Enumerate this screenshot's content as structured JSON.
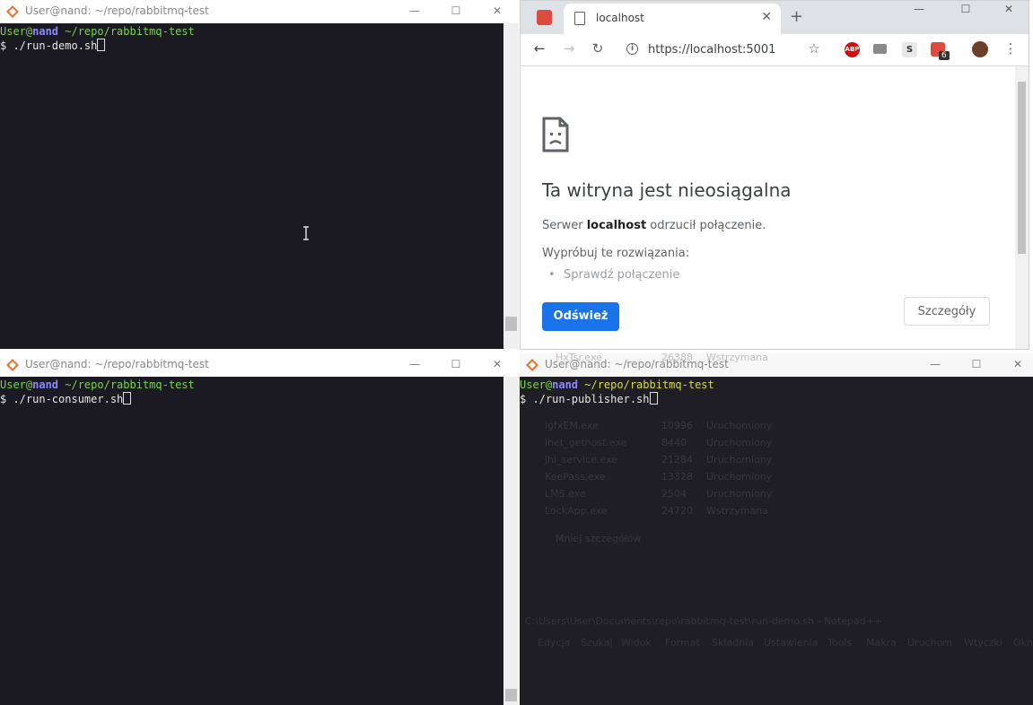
{
  "terminals": {
    "demo": {
      "title": "User@nand: ~/repo/rabbitmq-test",
      "prompt_user": "User@",
      "prompt_host": "nand",
      "prompt_path": " ~/repo/rabbitmq-test",
      "dollar": "$",
      "command": " ./run-demo.sh"
    },
    "consumer": {
      "title": "User@nand: ~/repo/rabbitmq-test",
      "prompt_user": "User@",
      "prompt_host": "nand",
      "prompt_path": " ~/repo/rabbitmq-test",
      "dollar": "$",
      "command": " ./run-consumer.sh"
    },
    "publisher": {
      "title": "User@nand: ~/repo/rabbitmq-test",
      "prompt_user": "User@",
      "prompt_host": "nand",
      "prompt_path": " ~/repo/rabbitmq-test",
      "dollar": "$",
      "command": " ./run-publisher.sh"
    }
  },
  "window_buttons": {
    "minimize": "—",
    "maximize": "☐",
    "close": "✕"
  },
  "browser": {
    "tab_title": "localhost",
    "tab_close": "✕",
    "new_tab": "+",
    "url": "https://localhost:5001",
    "nav": {
      "back": "←",
      "forward": "→",
      "reload": "↻",
      "star": "☆",
      "menu": "⋮"
    },
    "extensions": {
      "abp": "ABP",
      "s": "S",
      "todoist_badge": "6"
    },
    "error": {
      "title": "Ta witryna jest nieosiągalna",
      "server_prefix": "Serwer ",
      "server_host": "localhost",
      "server_suffix": " odrzucił połączenie.",
      "try_label": "Wypróbuj te rozwiązania:",
      "suggestion": "Sprawdź połączenie",
      "reload_button": "Odśwież",
      "details_button": "Szczegóły"
    }
  },
  "background": {
    "task_rows": [
      {
        "name": "HxTsr.exe",
        "pid": "26388",
        "status": "Wstrzymana"
      },
      {
        "name": "igfxEM.exe",
        "pid": "10996",
        "status": "Uruchomiony"
      },
      {
        "name": "inet_gethost.exe",
        "pid": "8440",
        "status": "Uruchomiony"
      },
      {
        "name": "jhi_service.exe",
        "pid": "21284",
        "status": "Uruchomiony"
      },
      {
        "name": "KeePass.exe",
        "pid": "13328",
        "status": "Uruchomiony"
      },
      {
        "name": "LMS.exe",
        "pid": "2504",
        "status": "Uruchomiony"
      },
      {
        "name": "LockApp.exe",
        "pid": "24720",
        "status": "Wstrzymana"
      }
    ],
    "fewer_details": "Mniej szczegółów",
    "notepad_title": "C:\\Users\\User\\Documents\\repo\\rabbitmq-test\\run-demo.sh - Notepad++",
    "notepad_menu": [
      "Edycja",
      "Szukaj",
      "Widok",
      "Format",
      "Składnia",
      "Ustawienia",
      "Tools",
      "Makra",
      "Uruchom",
      "Wtyczki",
      "Okno"
    ]
  }
}
